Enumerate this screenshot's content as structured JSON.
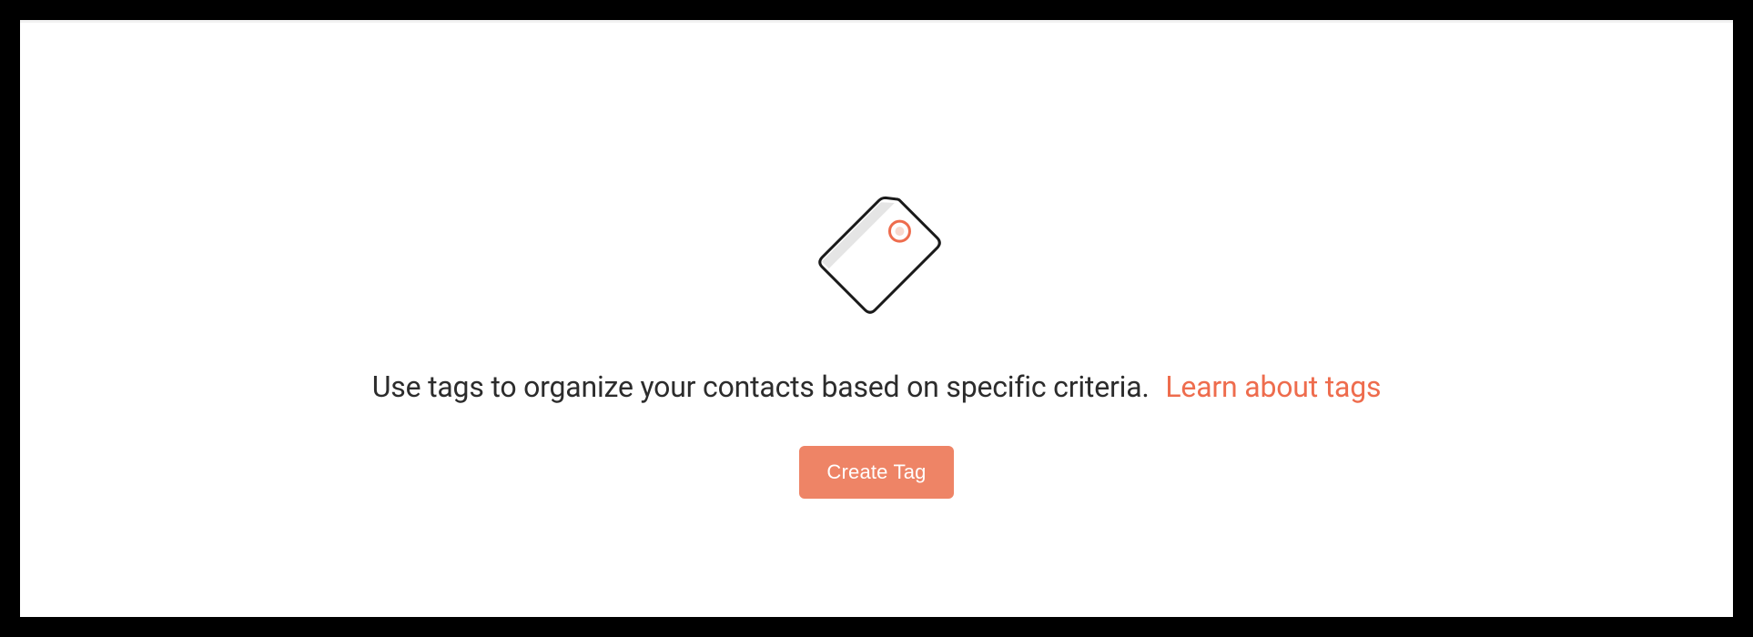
{
  "empty_state": {
    "description": "Use tags to organize your contacts based on specific criteria.",
    "learn_link_label": "Learn about tags",
    "create_button_label": "Create Tag",
    "icon_name": "tag-icon"
  },
  "colors": {
    "accent": "#ee6c4d",
    "button_bg": "#ee8466",
    "text": "#2c2c2c"
  }
}
